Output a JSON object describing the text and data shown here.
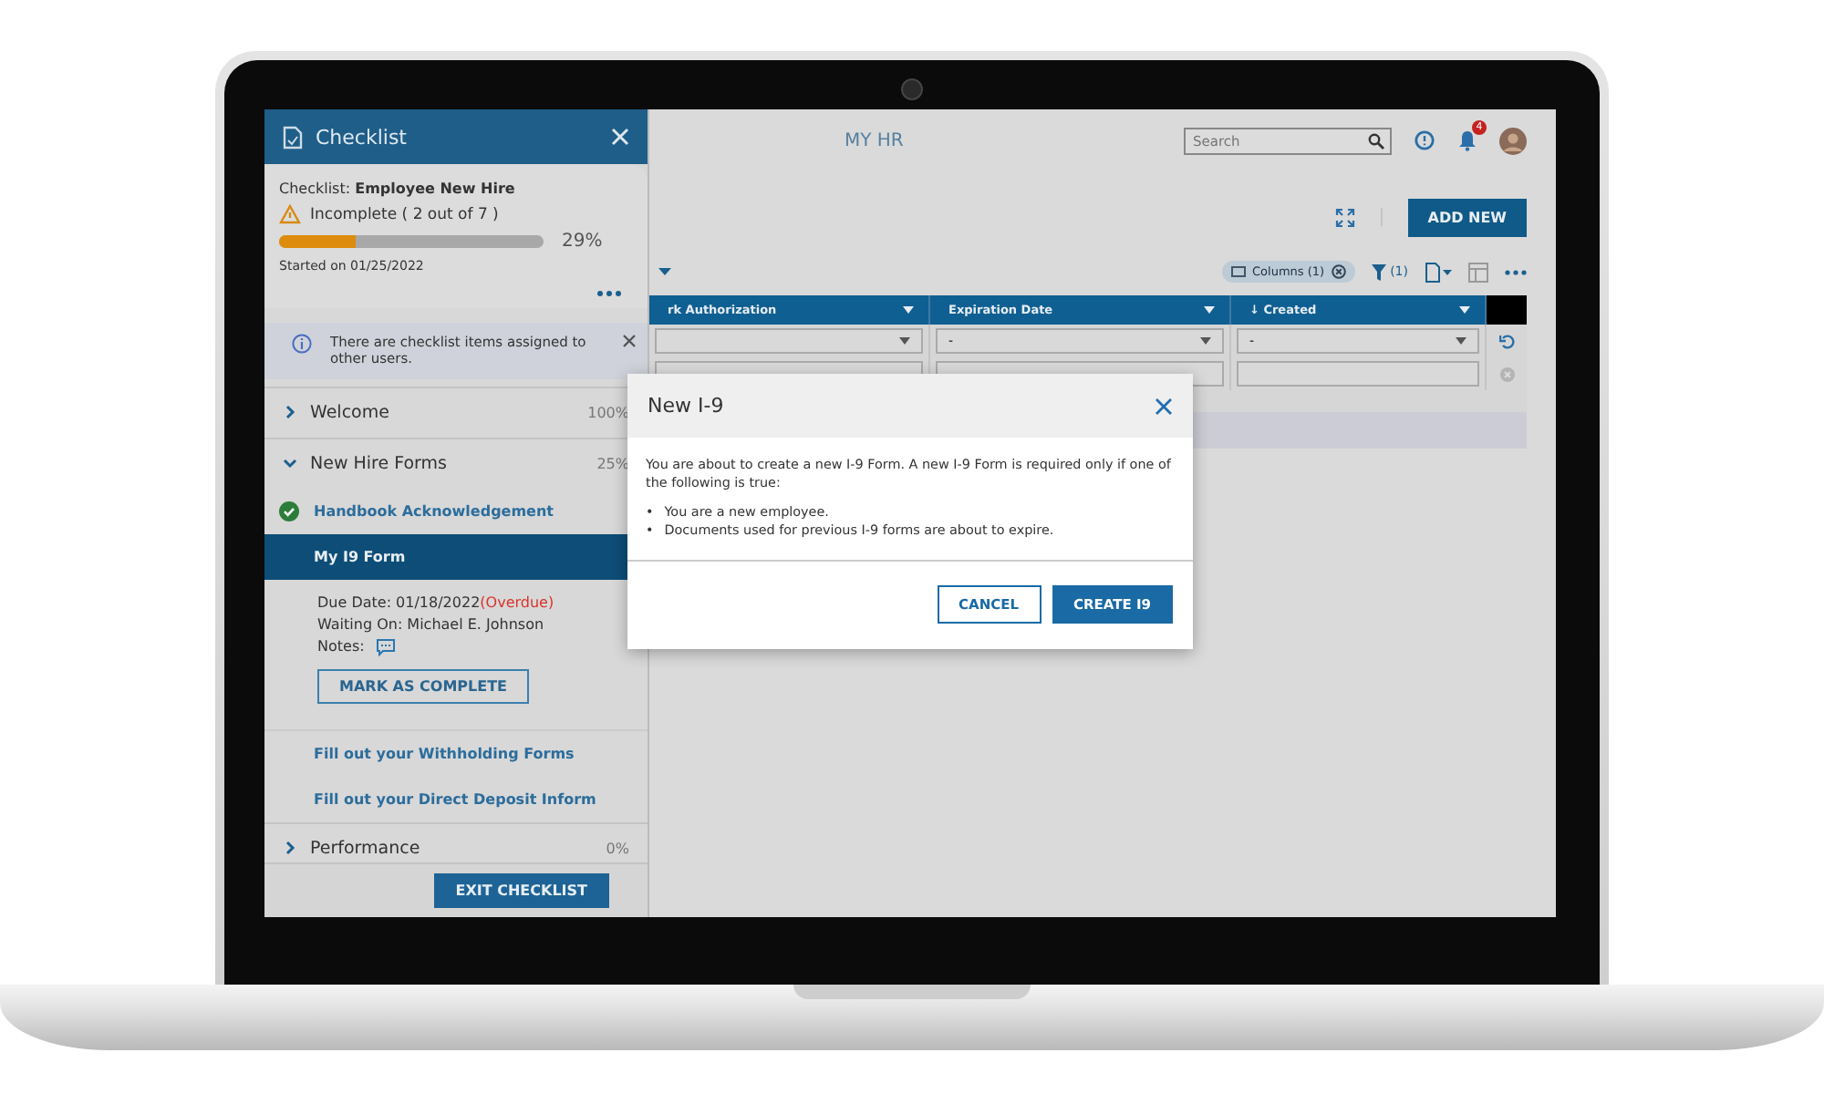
{
  "checklist_panel": {
    "title": "Checklist",
    "checklist_name": "Checklist: **Employee New Hire**",
    "status": "Incomplete ( 2 out of 7 )",
    "level": 0.29,
    "percent": "29%",
    "started": "Started on 01/25/2022",
    "notice": "There are checklist items assigned to other users.",
    "sections": [
      {
        "title": "Welcome",
        "percent": "100%",
        "expanded": false
      },
      {
        "title": "New Hire Forms",
        "percent": "25%",
        "expanded": true,
        "items": [
          {
            "label": "Handbook Acknowledgement",
            "done": true,
            "selected": false
          },
          {
            "label": "My I9 Form",
            "done": false,
            "selected": true,
            "details": {
              "due_label": "Due Date: 01/18/2022",
              "overdue": "(Overdue)",
              "waiting": "Waiting On: Michael E. Johnson",
              "notes": "Notes:",
              "button": "MARK AS COMPLETE"
            }
          },
          {
            "label": "Fill out your Withholding Forms",
            "done": false,
            "selected": false
          },
          {
            "label": "Fill out your Direct Deposit Inform",
            "done": false,
            "selected": false
          }
        ]
      },
      {
        "title": "Performance",
        "percent": "0%",
        "expanded": false
      }
    ],
    "exit_button": "EXIT CHECKLIST"
  },
  "header": {
    "app_title": "MY HR",
    "search": {
      "placeholder": "Search"
    },
    "notification_count": "4"
  },
  "actions": {
    "add_button": "ADD NEW"
  },
  "toolbar": {
    "columns_chip": "Columns (1)",
    "filter_count": "(1)"
  },
  "table": {
    "columns": [
      "rk Authorization",
      "Expiration Date",
      "↓ Created"
    ],
    "filters": [
      {
        "kind": "dropdown"
      },
      {
        "kind": "dropdown",
        "value": "-"
      },
      {
        "kind": "dropdown",
        "value": "-"
      }
    ]
  },
  "modal": {
    "title": "New I-9",
    "text": "You are about to create a new I-9 Form. A new I-9 Form is required only if one of the following is true:",
    "bullets": [
      {
        "marker": "•",
        "text": "You are a new employee."
      },
      {
        "marker": "•",
        "text": "Documents used for previous I-9 forms are about to expire."
      }
    ],
    "buttons": [
      {
        "label": "CANCEL",
        "kind": "secondary"
      },
      {
        "label": "CREATE I9",
        "kind": "primary"
      }
    ]
  }
}
